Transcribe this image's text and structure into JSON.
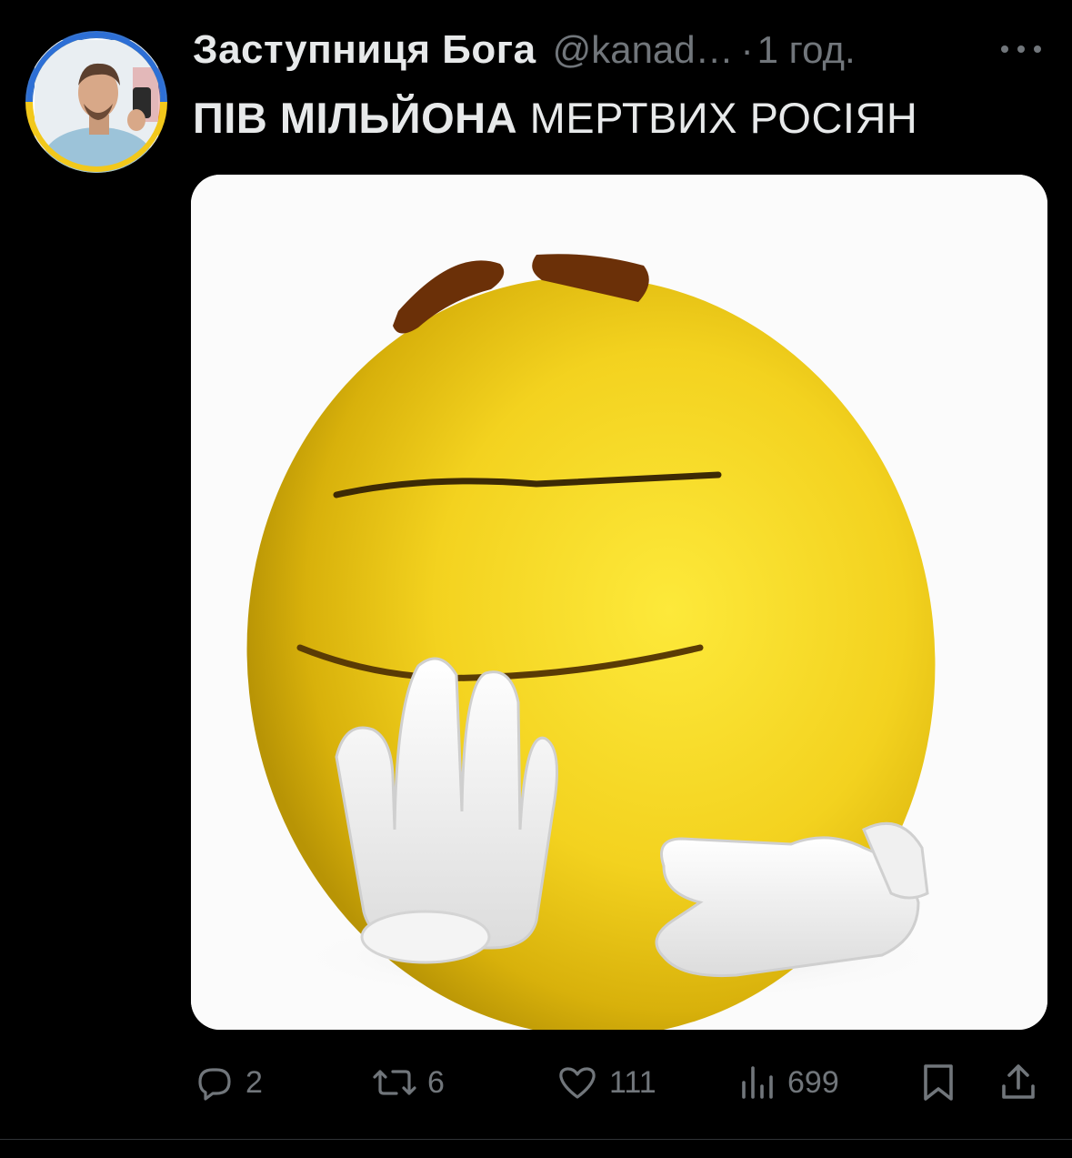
{
  "tweet": {
    "author": {
      "display_name": "Заступниця Бога",
      "handle": "@kanad…",
      "separator": "·",
      "time": "1 год."
    },
    "text_bold": "ПІВ МІЛЬЙОНА",
    "text_rest": " МЕРТВИХ РОСІЯН",
    "media_icon": "yellow-smiley-emoji-image"
  },
  "actions": {
    "replies": "2",
    "reposts": "6",
    "likes": "111",
    "views": "699"
  },
  "colors": {
    "background": "#000000",
    "text": "#e7e9ea",
    "muted": "#71767b",
    "divider": "#2f3336"
  }
}
